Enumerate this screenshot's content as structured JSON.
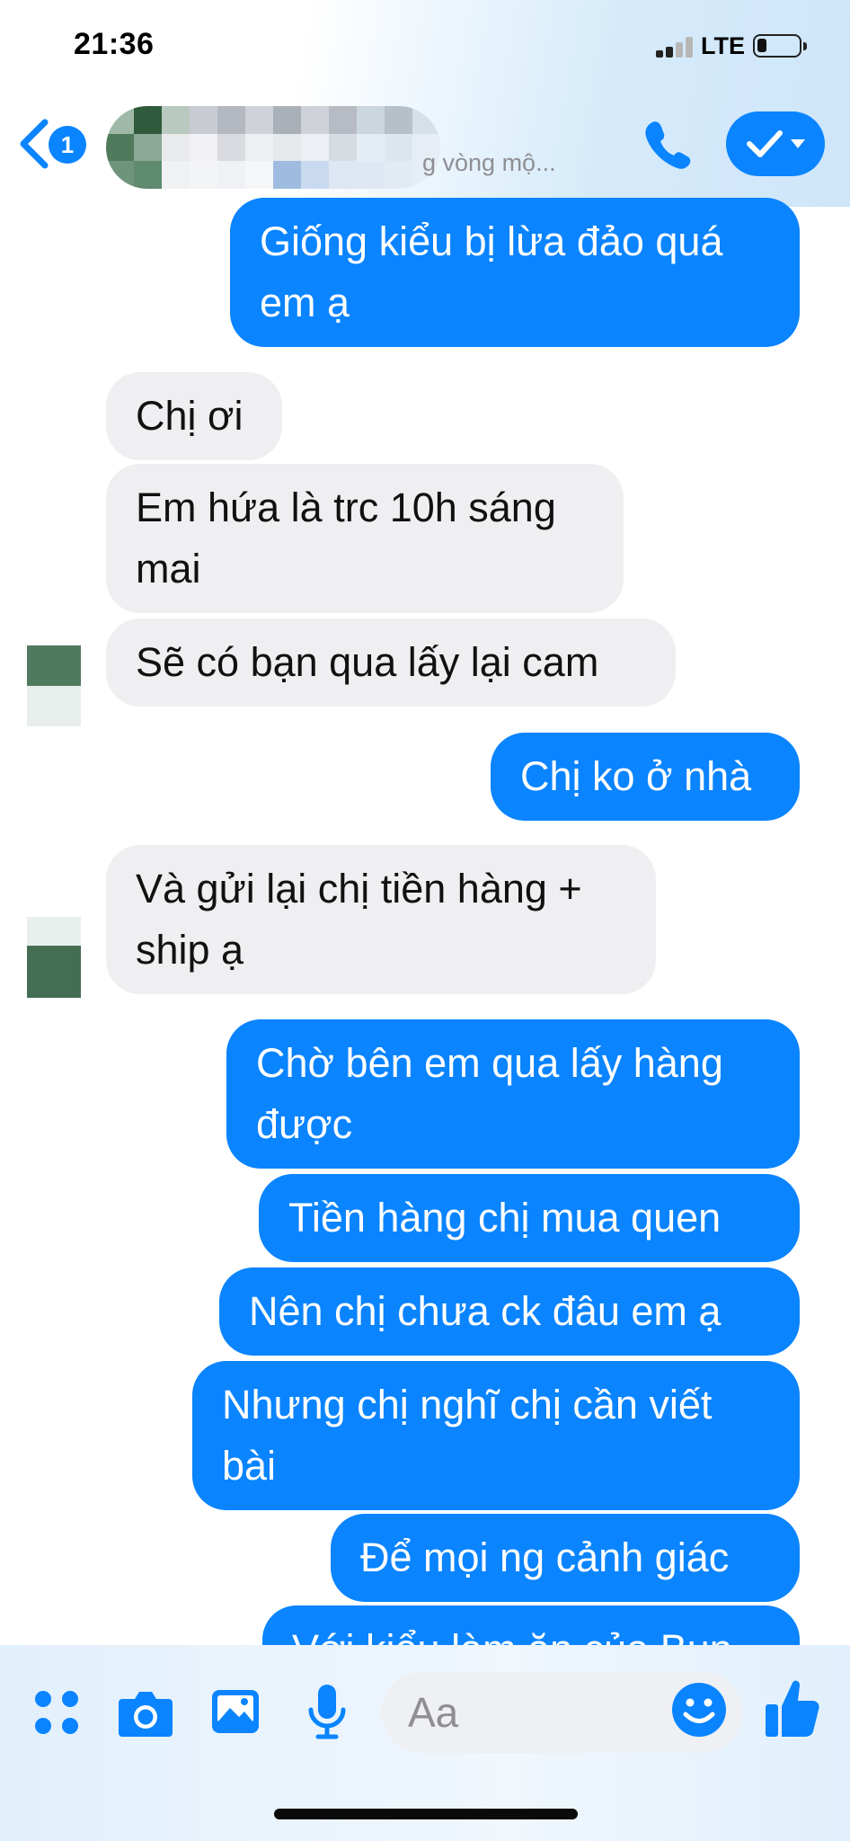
{
  "status_bar": {
    "time": "21:36",
    "network": "LTE",
    "battery_icon": "battery-low-icon"
  },
  "header": {
    "back_badge": "1",
    "contact_status": "g vòng mộ...",
    "icons": [
      "back-chevron-icon",
      "phone-icon",
      "video-checkmark-icon"
    ]
  },
  "messages": [
    {
      "side": "out",
      "text": "Giống kiểu bị lừa đảo quá\nem ạ"
    },
    {
      "side": "in",
      "text": "Chị ơi"
    },
    {
      "side": "in",
      "text": "Em hứa là trc 10h sáng\nmai"
    },
    {
      "side": "in",
      "text": "Sẽ có bạn qua lấy lại cam"
    },
    {
      "side": "out",
      "text": "Chị ko ở nhà"
    },
    {
      "side": "in",
      "text": "Và gửi lại chị tiền hàng +\nship ạ"
    },
    {
      "side": "out",
      "text": "Chờ bên em qua lấy hàng\nđược"
    },
    {
      "side": "out",
      "text": "Tiền hàng chị mua quen"
    },
    {
      "side": "out",
      "text": "Nên chị chưa ck đâu em ạ"
    },
    {
      "side": "out",
      "text": "Nhưng chị nghĩ chị cần viết\nbài"
    },
    {
      "side": "out",
      "text": "Để mọi ng cảnh giác"
    },
    {
      "side": "out",
      "text": "Với kiểu làm ăn của Bun"
    }
  ],
  "composer": {
    "placeholder": "Aa",
    "icons": [
      "apps-grid-icon",
      "camera-icon",
      "photo-gallery-icon",
      "microphone-icon",
      "emoji-icon",
      "thumbs-up-icon"
    ]
  },
  "colors": {
    "accent": "#0a84ff",
    "incoming_bubble": "#efeff2"
  }
}
